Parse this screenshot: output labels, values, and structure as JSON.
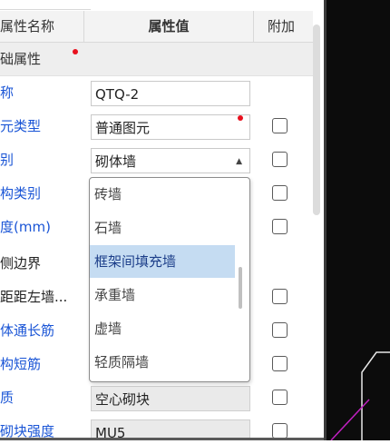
{
  "header": {
    "name": "属性名称",
    "value": "属性值",
    "extra": "附加"
  },
  "group": {
    "label": "础属性"
  },
  "rows": [
    {
      "label": "称",
      "value": "QTQ-2"
    },
    {
      "label": "元类型",
      "value": "普通图元"
    },
    {
      "label": "别",
      "value": "砌体墙"
    },
    {
      "label": "构类别",
      "value": ""
    },
    {
      "label": "度(mm)",
      "value": ""
    },
    {
      "label": "侧边界",
      "value": ""
    },
    {
      "label": "距距左墙...",
      "value": ""
    },
    {
      "label": "体通长筋",
      "value": ""
    },
    {
      "label": "构短筋",
      "value": ""
    },
    {
      "label": "质",
      "value": "空心砌块"
    },
    {
      "label": "砌块强度",
      "value": "MU5"
    }
  ],
  "dropdown": {
    "options": [
      "砖墙",
      "石墙",
      "框架间填充墙",
      "承重墙",
      "虚墙",
      "轻质隔墙"
    ],
    "selected": "框架间填充墙"
  },
  "colors": {
    "label_blue": "#1a55d6",
    "required_dot": "#e8101e",
    "selection": "#c5dcf2"
  }
}
